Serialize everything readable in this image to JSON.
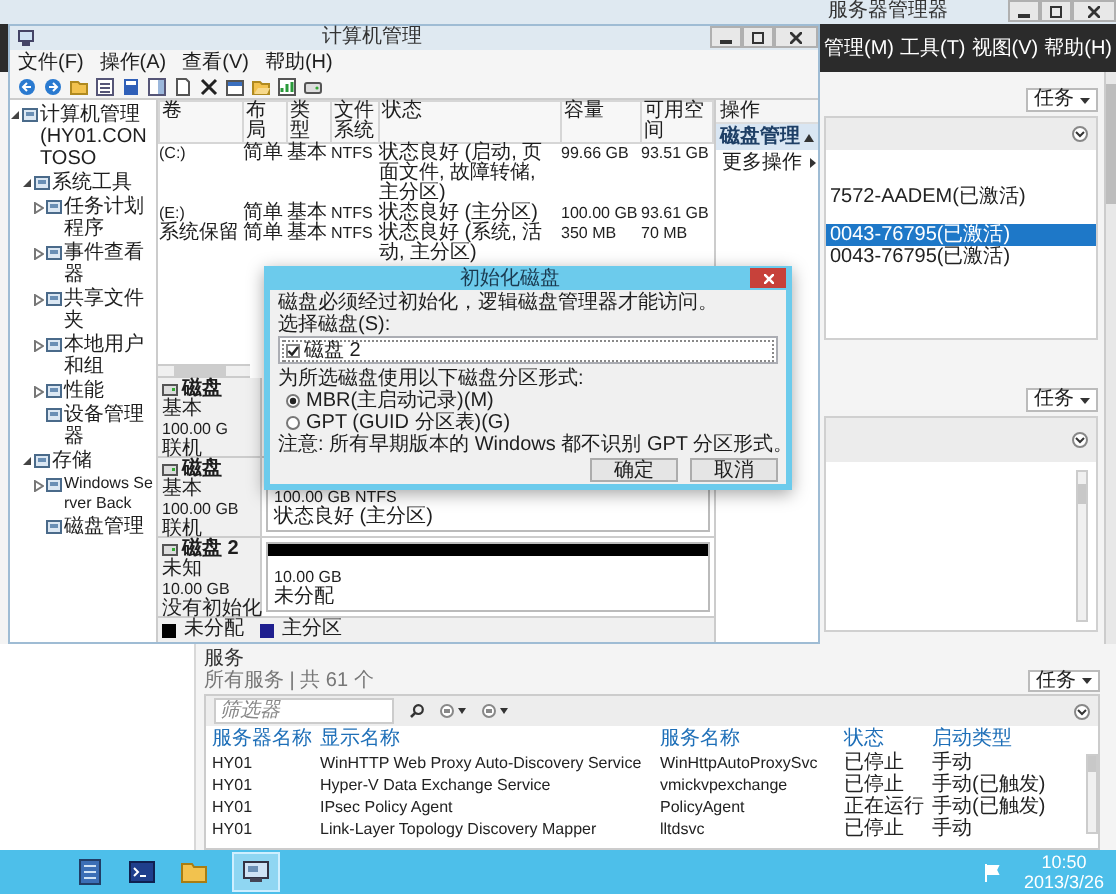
{
  "server_manager": {
    "title": "服务器管理器",
    "menus": [
      "管理(M)",
      "工具(T)",
      "视图(V)",
      "帮助(H)"
    ],
    "license_panel": {
      "task_button": "任务",
      "rows": [
        {
          "text": "7572-AADEM(已激活)",
          "selected": false
        },
        {
          "text": "0043-76795(已激活)",
          "selected": true
        },
        {
          "text": "0043-76795(已激活)",
          "selected": false
        }
      ]
    },
    "second_panel": {
      "task_button": "任务"
    },
    "services": {
      "title": "服务",
      "subtitle": "所有服务 | 共 61 个",
      "task_button": "任务",
      "filter": {
        "placeholder": "筛选器"
      },
      "columns": [
        "服务器名称",
        "显示名称",
        "服务名称",
        "状态",
        "启动类型"
      ],
      "rows": [
        [
          "HY01",
          "WinHTTP Web Proxy Auto-Discovery Service",
          "WinHttpAutoProxySvc",
          "已停止",
          "手动"
        ],
        [
          "HY01",
          "Hyper-V Data Exchange Service",
          "vmickvpexchange",
          "已停止",
          "手动(已触发)"
        ],
        [
          "HY01",
          "IPsec Policy Agent",
          "PolicyAgent",
          "正在运行",
          "手动(已触发)"
        ],
        [
          "HY01",
          "Link-Layer Topology Discovery Mapper",
          "lltdsvc",
          "已停止",
          "手动"
        ]
      ]
    }
  },
  "computer_management": {
    "title": "计算机管理",
    "menus": [
      "文件(F)",
      "操作(A)",
      "查看(V)",
      "帮助(H)"
    ],
    "tree": [
      {
        "label": "计算机管理 (HY01.CONTOSO",
        "kind": "branch",
        "expanded": true,
        "children": [
          {
            "label": "系统工具",
            "kind": "branch",
            "expanded": true,
            "children": [
              {
                "label": "任务计划程序",
                "kind": "branch",
                "expanded": false
              },
              {
                "label": "事件查看器",
                "kind": "branch",
                "expanded": false
              },
              {
                "label": "共享文件夹",
                "kind": "branch",
                "expanded": false
              },
              {
                "label": "本地用户和组",
                "kind": "branch",
                "expanded": false
              },
              {
                "label": "性能",
                "kind": "branch",
                "expanded": false
              },
              {
                "label": "设备管理器",
                "kind": "leaf"
              }
            ]
          },
          {
            "label": "存储",
            "kind": "branch",
            "expanded": true,
            "children": [
              {
                "label": "Windows Server Back",
                "kind": "branch",
                "expanded": false
              },
              {
                "label": "磁盘管理",
                "kind": "leaf"
              }
            ]
          }
        ]
      }
    ],
    "volumes": {
      "columns": [
        "卷",
        "布局",
        "类型",
        "文件系统",
        "状态",
        "容量",
        "可用空间"
      ],
      "rows": [
        [
          "(C:)",
          "简单",
          "基本",
          "NTFS",
          "状态良好 (启动, 页面文件, 故障转储, 主分区)",
          "99.66 GB",
          "93.51 GB"
        ],
        [
          "(E:)",
          "简单",
          "基本",
          "NTFS",
          "状态良好 (主分区)",
          "100.00 GB",
          "93.61 GB"
        ],
        [
          "系统保留",
          "简单",
          "基本",
          "NTFS",
          "状态良好 (系统, 活动, 主分区)",
          "350 MB",
          "70 MB"
        ]
      ]
    },
    "disks": [
      {
        "name": "磁盘",
        "type": "基本",
        "size": "100.00 G",
        "status": "联机"
      },
      {
        "name": "磁盘",
        "type": "基本",
        "size": "100.00 GB",
        "status": "联机",
        "partitions": [
          {
            "kind": "primary",
            "size": "100.00 GB NTFS",
            "state": "状态良好 (主分区)"
          }
        ]
      },
      {
        "name": "磁盘 2",
        "type": "未知",
        "size": "10.00 GB",
        "status": "没有初始化",
        "partitions": [
          {
            "kind": "unallocated",
            "size": "10.00 GB",
            "state": "未分配"
          }
        ]
      }
    ],
    "legend": [
      {
        "label": "未分配",
        "color": "#000000"
      },
      {
        "label": "主分区",
        "color": "#1f1f8f"
      }
    ],
    "actions": {
      "title": "操作",
      "section": "磁盘管理",
      "items": [
        "更多操作"
      ]
    }
  },
  "dialog": {
    "title": "初始化磁盘",
    "message": "磁盘必须经过初始化，逻辑磁盘管理器才能访问。",
    "select_label": "选择磁盘(S):",
    "disks": [
      {
        "label": "磁盘 2",
        "checked": true
      }
    ],
    "style_label": "为所选磁盘使用以下磁盘分区形式:",
    "options": [
      {
        "label": "MBR(主启动记录)(M)",
        "selected": true
      },
      {
        "label": "GPT (GUID 分区表)(G)",
        "selected": false
      }
    ],
    "note": "注意: 所有早期版本的 Windows 都不识别 GPT 分区形式。",
    "buttons": [
      "确定",
      "取消"
    ]
  },
  "taskbar": {
    "time": "10:50",
    "date": "2013/3/26"
  }
}
